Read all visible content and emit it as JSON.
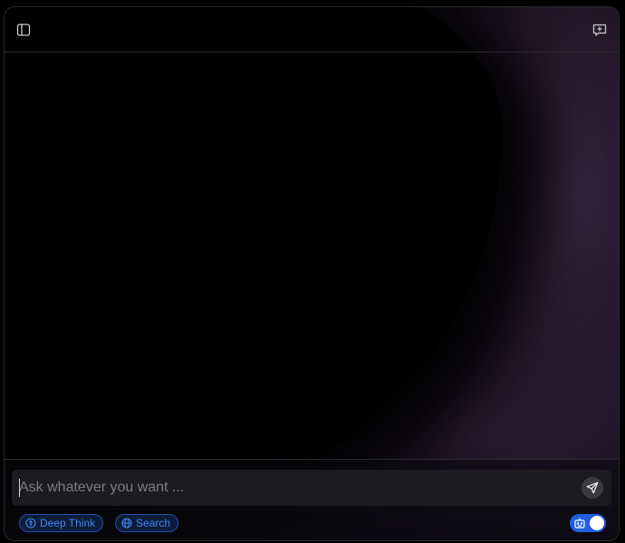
{
  "header": {
    "sidebar_icon": "sidebar-toggle-icon",
    "new_chat_icon": "new-chat-icon"
  },
  "composer": {
    "placeholder": "Ask whatever you want ...",
    "value": "",
    "send_icon": "send-icon"
  },
  "options": {
    "deep_think": {
      "label": "Deep Think",
      "icon": "brain-icon"
    },
    "search": {
      "label": "Search",
      "icon": "globe-icon"
    },
    "bot_toggle": {
      "icon": "robot-icon",
      "on": true
    }
  },
  "colors": {
    "accent": "#1f5fe0",
    "chip_text": "#3e86f0",
    "chip_border": "#1f4fa8",
    "bg_glow": "#3a2a45"
  }
}
